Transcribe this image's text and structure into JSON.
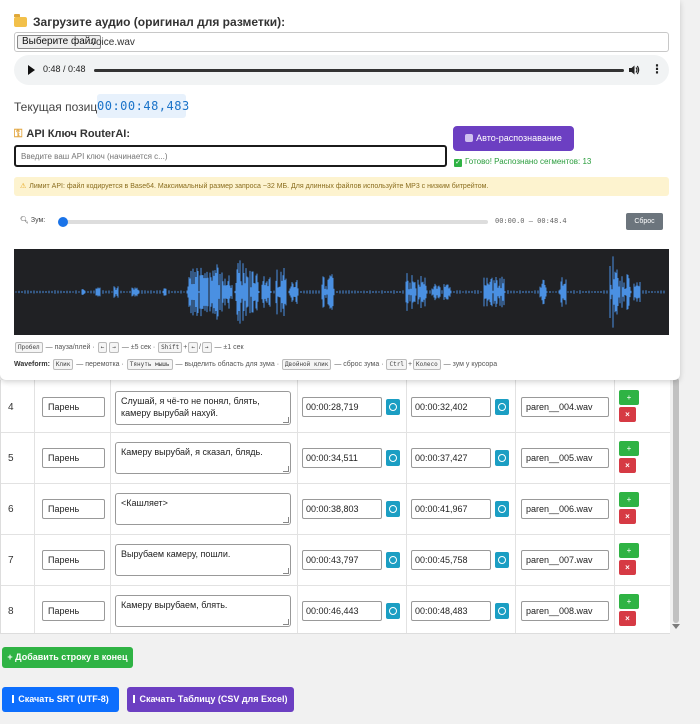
{
  "upload": {
    "title": "Загрузите аудио (оригинал для разметки):",
    "button": "Выберите файл",
    "filename": "voice.wav"
  },
  "player": {
    "time": "0:48 / 0:48"
  },
  "position": {
    "label": "Текущая позиция:",
    "value": "00:00:48,483"
  },
  "api": {
    "label": "API Ключ RouterAI:",
    "placeholder": "Введите ваш API ключ (начинается с...)",
    "auto_button": "Авто-распознавание",
    "status": "Готово! Распознано сегментов: 13"
  },
  "warning": "Лимит API: файл кодируется в Base64. Максимальный размер запроса ~32 МБ. Для длинных файлов используйте MP3 с низким битрейтом.",
  "zoom": {
    "label": "Зум:",
    "range": "00:00.0 — 00:48.4",
    "reset": "Сброс"
  },
  "waveform": {
    "color": "#4a90e2",
    "background": "#202124"
  },
  "hints": {
    "k_space": "Пробел",
    "t_pause": "— пауза/плей ·",
    "k_left": "←",
    "k_right": "→",
    "t_5sec": "— ±5 сек ·",
    "k_shift": "Shift",
    "k_left2": "←",
    "k_right2": "→",
    "t_1sec": "— ±1 сек",
    "wave_label": "Waveform:",
    "k_click": "Клик",
    "t_seek": "— перемотка ·",
    "k_drag": "Тянуть мышь",
    "t_select": "— выделить область для зума ·",
    "k_dbl": "Двойной клик",
    "t_reset": "— сброс зума ·",
    "k_ctrl": "Ctrl",
    "k_wheel": "Колесо",
    "t_cursor": "— зум у курсора"
  },
  "rows": [
    {
      "num": "4",
      "speaker": "Парень",
      "text": "Слушай, я чё-то не понял, блять, камеру вырубай нахуй.",
      "start": "00:00:28,719",
      "end": "00:00:32,402",
      "file": "paren__004.wav"
    },
    {
      "num": "5",
      "speaker": "Парень",
      "text": "Камеру вырубай, я сказал, блядь.",
      "start": "00:00:34,511",
      "end": "00:00:37,427",
      "file": "paren__005.wav"
    },
    {
      "num": "6",
      "speaker": "Парень",
      "text": "<Кашляет>",
      "start": "00:00:38,803",
      "end": "00:00:41,967",
      "file": "paren__006.wav"
    },
    {
      "num": "7",
      "speaker": "Парень",
      "text": "Вырубаем камеру, пошли.",
      "start": "00:00:43,797",
      "end": "00:00:45,758",
      "file": "paren__007.wav"
    },
    {
      "num": "8",
      "speaker": "Парень",
      "text": "Камеру вырубаем, блять.",
      "start": "00:00:46,443",
      "end": "00:00:48,483",
      "file": "paren__008.wav"
    }
  ],
  "buttons": {
    "add_row": "+ Добавить строку в конец",
    "srt": "Скачать SRT (UTF-8)",
    "csv": "Скачать Таблицу (CSV для Excel)"
  }
}
